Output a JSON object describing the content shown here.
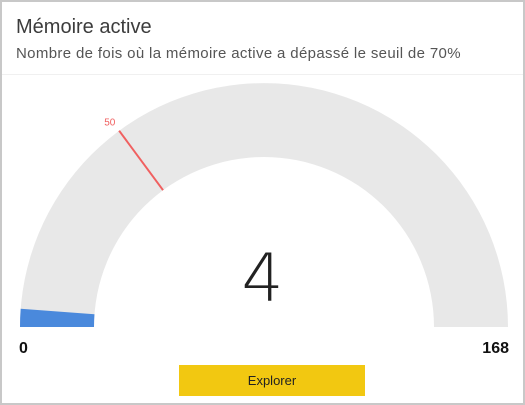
{
  "card": {
    "title": "Mémoire active",
    "subtitle": "Nombre de fois où la mémoire active a dépassé le seuil de 70%"
  },
  "gauge": {
    "value": "4",
    "value_number": 4,
    "min": "0",
    "max": "168",
    "min_number": 0,
    "max_number": 168,
    "target": "50",
    "target_number": 50,
    "colors": {
      "track": "#e8e8e8",
      "fill": "#4a89dc",
      "target": "#f06060"
    }
  },
  "actions": {
    "explore_label": "Explorer"
  }
}
